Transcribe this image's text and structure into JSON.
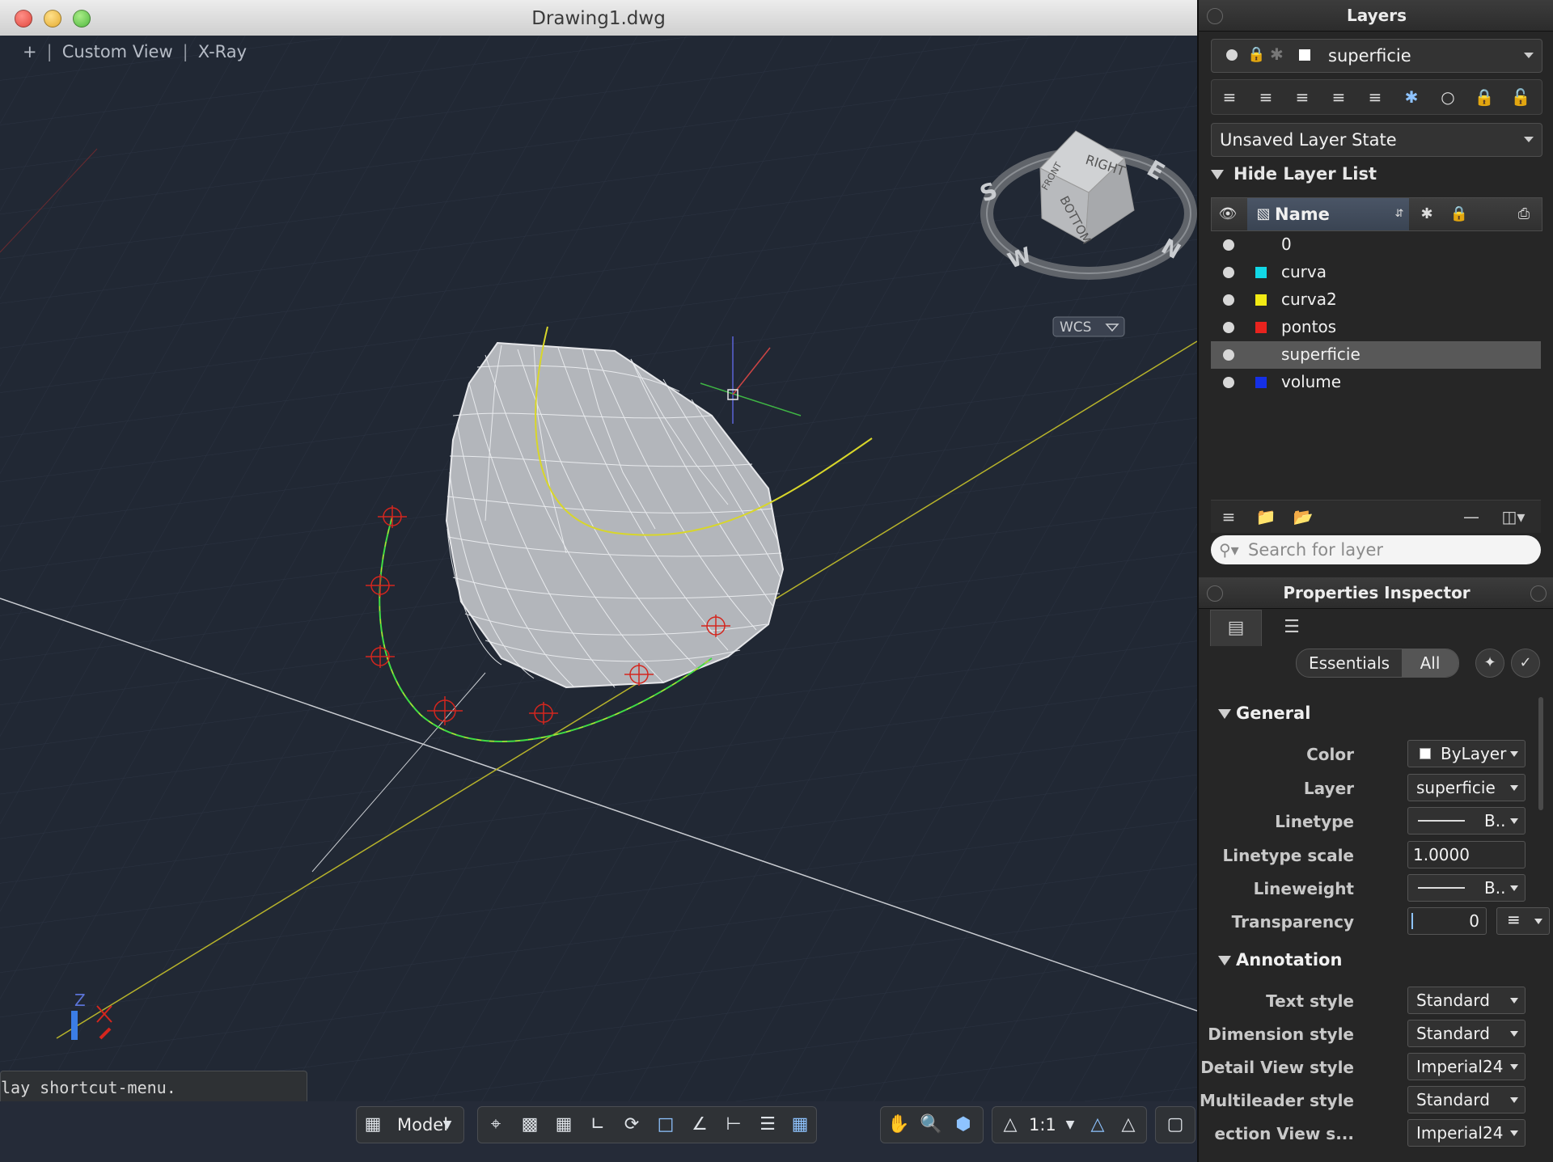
{
  "window": {
    "title": "Drawing1.dwg"
  },
  "viewport": {
    "plus_label": "+",
    "view_label": "Custom View",
    "visual_style": "X-Ray",
    "viewcube": {
      "face_top": "RIGHT",
      "face_front": "FRONT",
      "face_bottom": "BOTTOM",
      "compass": [
        "S",
        "E",
        "N",
        "W"
      ],
      "wcs_label": "WCS"
    },
    "axis_label": "Z"
  },
  "command_line": {
    "text": "lay shortcut-menu."
  },
  "status_bar": {
    "model_label": "Model",
    "scale_label": "1:1"
  },
  "layers_panel": {
    "title": "Layers",
    "current_layer": "superficie",
    "layer_state": "Unsaved Layer State",
    "hide_list_label": "Hide Layer List",
    "name_header": "Name",
    "layers": [
      {
        "name": "0",
        "color": "#262626"
      },
      {
        "name": "curva",
        "color": "#12d8e6"
      },
      {
        "name": "curva2",
        "color": "#f2ea14"
      },
      {
        "name": "pontos",
        "color": "#e8231e"
      },
      {
        "name": "superficie",
        "color": "#585858"
      },
      {
        "name": "volume",
        "color": "#1530e6"
      }
    ],
    "selected_layer": "superficie",
    "search_placeholder": "Search for layer"
  },
  "properties_panel": {
    "title": "Properties Inspector",
    "seg_essentials": "Essentials",
    "seg_all": "All",
    "sections": [
      {
        "name": "General",
        "rows": [
          {
            "label": "Color",
            "value": "ByLayer"
          },
          {
            "label": "Layer",
            "value": "superficie"
          },
          {
            "label": "Linetype",
            "value": "B.."
          },
          {
            "label": "Linetype scale",
            "value": "1.0000"
          },
          {
            "label": "Lineweight",
            "value": "B.."
          },
          {
            "label": "Transparency",
            "value": "0"
          }
        ]
      },
      {
        "name": "Annotation",
        "rows": [
          {
            "label": "Text style",
            "value": "Standard"
          },
          {
            "label": "Dimension style",
            "value": "Standard"
          },
          {
            "label": "Detail View style",
            "value": "Imperial24"
          },
          {
            "label": "Multileader style",
            "value": "Standard"
          },
          {
            "label": "ection View s...",
            "value": "Imperial24"
          }
        ]
      }
    ]
  },
  "colors": {
    "viewport_bg": "#212834",
    "curve_yellow": "#d8d62a",
    "curve_green": "#3fdc45",
    "point_red": "#d4261e",
    "accent_blue": "#8ec3ff"
  }
}
